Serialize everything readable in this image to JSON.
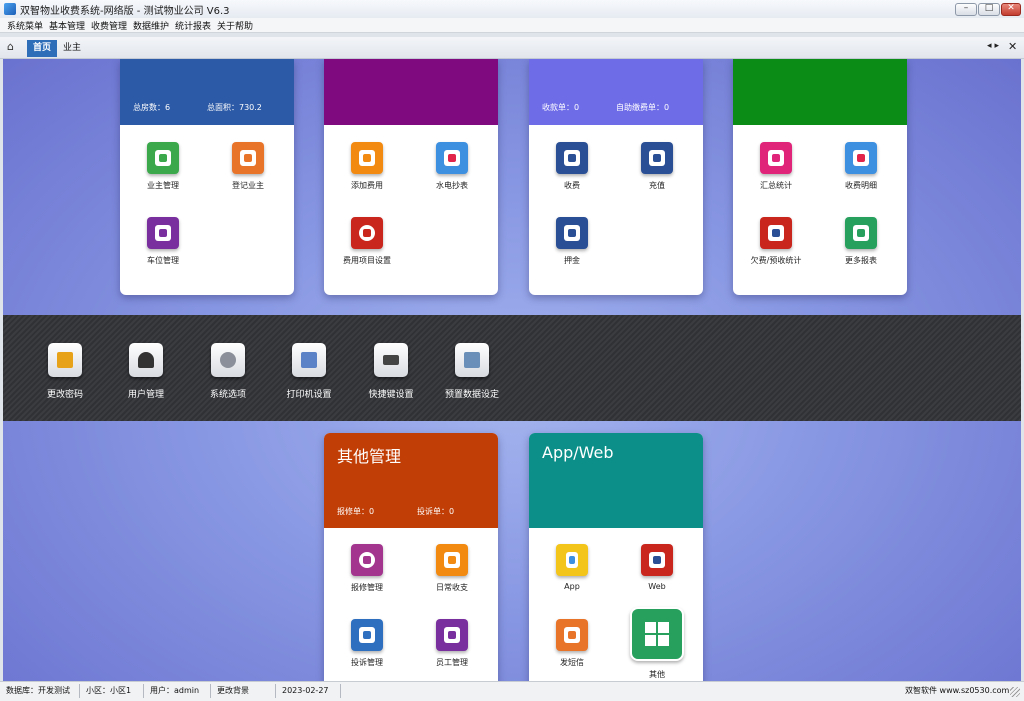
{
  "window": {
    "title": "双智物业收费系统-网络版 - 测试物业公司  V6.3",
    "min_glyph": "–",
    "max_glyph": "□",
    "close_glyph": "✕"
  },
  "menu": [
    "系统菜单",
    "基本管理",
    "收费管理",
    "数据维护",
    "统计报表",
    "关于帮助"
  ],
  "tabs": {
    "home_icon": "⌂",
    "home": "首页",
    "owner": "业主",
    "scroll": "◂▸",
    "close": "✕"
  },
  "colors": {
    "owner_header": "#2c5aa6",
    "fee_header": "#7f0a7f",
    "charge_header": "#6f6ce8",
    "report_header": "#0a8c16",
    "other_header": "#c13e06",
    "app_header": "#0b8f88"
  },
  "cards": {
    "owner": {
      "stats": [
        "总房数：6",
        "总面积：730.2"
      ],
      "items": [
        {
          "label": "业主管理",
          "icon": "document-person-icon",
          "color": "#3aa84b"
        },
        {
          "label": "登记业主",
          "icon": "person-register-icon",
          "color": "#e8742a"
        },
        {
          "label": "车位管理",
          "icon": "parking-person-icon",
          "color": "#7a2f9e"
        }
      ]
    },
    "fee": {
      "items": [
        {
          "label": "添加费用",
          "icon": "add-fee-icon",
          "color": "#f28a12"
        },
        {
          "label": "水电抄表",
          "icon": "meter-icon",
          "color": "#3d8fe0"
        },
        {
          "label": "费用项目设置",
          "icon": "money-bag-icon",
          "color": "#c9261e"
        }
      ]
    },
    "charge": {
      "stats": [
        "收款单：0",
        "自助缴费单：0"
      ],
      "items": [
        {
          "label": "收费",
          "icon": "cash-register-icon",
          "color": "#2a4f95"
        },
        {
          "label": "充值",
          "icon": "recharge-icon",
          "color": "#2a4f95"
        },
        {
          "label": "押金",
          "icon": "deposit-icon",
          "color": "#2a4f95"
        }
      ]
    },
    "report": {
      "items": [
        {
          "label": "汇总统计",
          "icon": "trend-chart-icon",
          "color": "#e0247a"
        },
        {
          "label": "收费明细",
          "icon": "detail-list-icon",
          "color": "#3d8fe0"
        },
        {
          "label": "欠费/预收统计",
          "icon": "arrears-icon",
          "color": "#c9261e"
        },
        {
          "label": "更多报表",
          "icon": "grid-icon",
          "color": "#27a05e"
        }
      ]
    },
    "other": {
      "title": "其他管理",
      "stats": [
        "报修单：0",
        "投诉单：0"
      ],
      "items": [
        {
          "label": "报修管理",
          "icon": "repair-location-icon",
          "color": "#a3358f"
        },
        {
          "label": "日常收支",
          "icon": "daily-ledger-icon",
          "color": "#f28a12"
        },
        {
          "label": "投诉管理",
          "icon": "complaint-icon",
          "color": "#2f6fc0"
        },
        {
          "label": "员工管理",
          "icon": "staff-badge-icon",
          "color": "#7a2f9e"
        }
      ]
    },
    "app": {
      "title": "App/Web",
      "items": [
        {
          "label": "App",
          "icon": "phone-icon",
          "color": "#f3c51b"
        },
        {
          "label": "Web",
          "icon": "web-icon",
          "color": "#c9261e"
        },
        {
          "label": "发短信",
          "icon": "sms-icon",
          "color": "#e8742a"
        },
        {
          "label": "其他",
          "icon": "windows-grid-icon",
          "color": "#27a05e"
        }
      ]
    }
  },
  "tools": [
    {
      "label": "更改密码",
      "icon": "lock-icon",
      "color": "#e8a21a"
    },
    {
      "label": "用户管理",
      "icon": "users-icon",
      "color": "#333333"
    },
    {
      "label": "系统选项",
      "icon": "gear-icon",
      "color": "#8a8f99"
    },
    {
      "label": "打印机设置",
      "icon": "printer-settings-icon",
      "color": "#5b82c6"
    },
    {
      "label": "快捷键设置",
      "icon": "keyboard-icon",
      "color": "#444444"
    },
    {
      "label": "预置数据设定",
      "icon": "network-data-icon",
      "color": "#6a8fb8"
    }
  ],
  "status": {
    "db": "数据库：开发测试",
    "area": "小区：小区1",
    "user": "用户：admin",
    "bg": "更改背景",
    "date": "2023-02-27",
    "vendor": "双智软件 www.sz0530.com"
  }
}
